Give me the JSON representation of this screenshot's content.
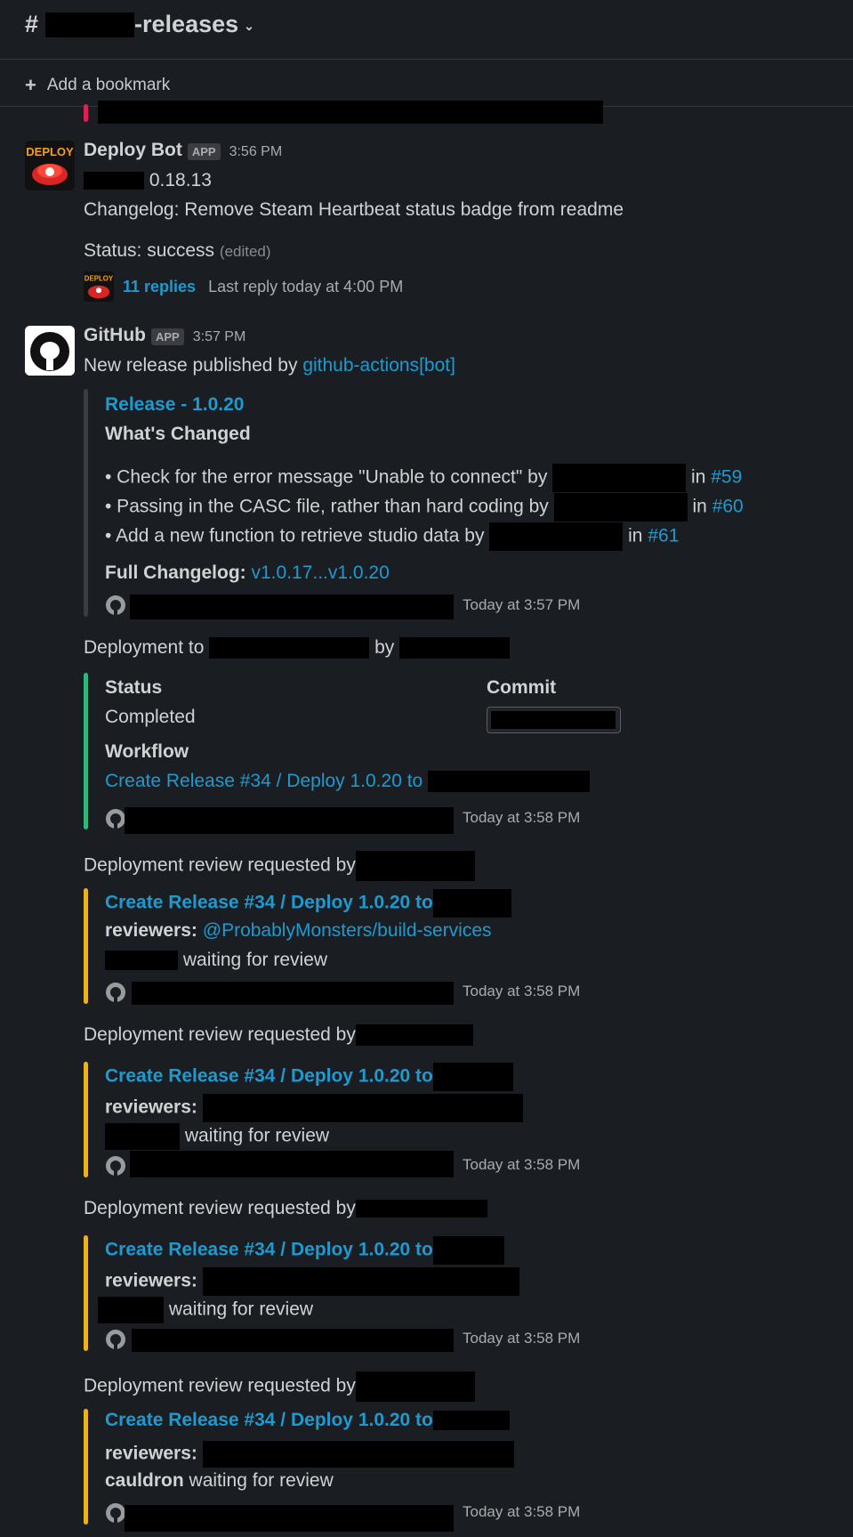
{
  "header": {
    "channel_suffix": "-releases",
    "bookmark_label": "Add a bookmark"
  },
  "deploy_bot": {
    "name": "Deploy Bot",
    "badge": "APP",
    "time": "3:56 PM",
    "version": "0.18.13",
    "changelog": "Changelog: Remove Steam Heartbeat status badge from readme",
    "status": "Status: success",
    "edited": "(edited)",
    "replies": "11 replies",
    "last_reply": "Last reply today at 4:00 PM"
  },
  "github": {
    "name": "GitHub",
    "badge": "APP",
    "time": "3:57 PM",
    "published_prefix": "New release published by",
    "published_by": "github-actions[bot]",
    "release": {
      "title": "Release - 1.0.20",
      "whats_changed": "What's Changed",
      "items": [
        {
          "text": "• Check for the error message \"Unable to connect\" by",
          "in": "in",
          "pr": "#59"
        },
        {
          "text": "• Passing in the CASC file, rather than hard coding by",
          "in": "in",
          "pr": "#60"
        },
        {
          "text": "• Add a new function to retrieve studio data by",
          "in": "in",
          "pr": "#61"
        }
      ],
      "full_changelog_label": "Full Changelog:",
      "full_changelog_link": "v1.0.17...v1.0.20",
      "footer_time": "Today at 3:57 PM"
    },
    "deployment": {
      "prefix": "Deployment to",
      "by": "by",
      "status_label": "Status",
      "status_value": "Completed",
      "commit_label": "Commit",
      "workflow_label": "Workflow",
      "workflow_link": "Create Release #34 / Deploy 1.0.20 to",
      "footer_time": "Today at 3:58 PM"
    },
    "reviews": [
      {
        "heading": "Deployment review requested by",
        "link": "Create Release #34 / Deploy 1.0.20 to",
        "reviewers_label": "reviewers:",
        "reviewers": "@ProbablyMonsters/build-services",
        "waiting": "waiting for review",
        "footer_time": "Today at 3:58 PM"
      },
      {
        "heading": "Deployment review requested by",
        "link": "Create Release #34 / Deploy 1.0.20 to",
        "reviewers_label": "reviewers:",
        "waiting": "waiting for review",
        "footer_time": "Today at 3:58 PM"
      },
      {
        "heading": "Deployment review requested by",
        "link": "Create Release #34 / Deploy 1.0.20 to",
        "reviewers_label": "reviewers:",
        "waiting": "waiting for review",
        "footer_time": "Today at 3:58 PM"
      },
      {
        "heading": "Deployment review requested by",
        "link": "Create Release #34 / Deploy 1.0.20 to",
        "reviewers_label": "reviewers:",
        "env": "cauldron",
        "waiting": "waiting for review",
        "footer_time": "Today at 3:58 PM"
      }
    ]
  }
}
